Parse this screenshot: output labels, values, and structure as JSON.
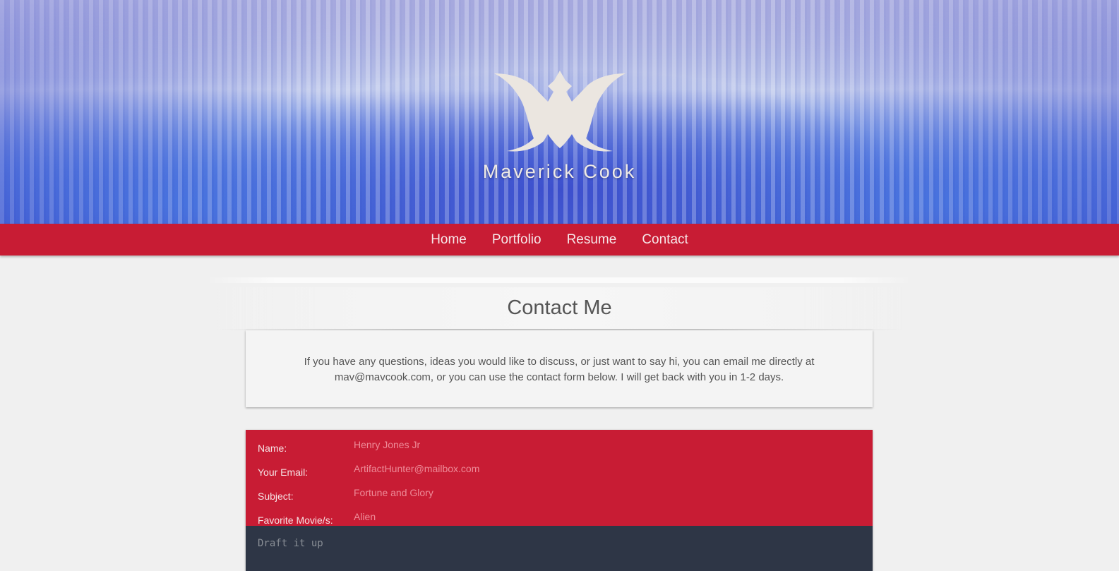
{
  "header": {
    "site_title": "Maverick Cook",
    "logo_icon": "winged-emblem-logo"
  },
  "nav": {
    "items": [
      {
        "label": "Home"
      },
      {
        "label": "Portfolio"
      },
      {
        "label": "Resume"
      },
      {
        "label": "Contact"
      }
    ]
  },
  "contact": {
    "title": "Contact Me",
    "intro": "If you have any questions, ideas you would like to discuss, or just want to say hi, you can email me directly at mav@mavcook.com, or you can use the contact form below. I will get back with you in 1-2 days."
  },
  "form": {
    "fields": [
      {
        "label": "Name:",
        "placeholder": "Henry Jones Jr"
      },
      {
        "label": "Your Email:",
        "placeholder": "ArtifactHunter@mailbox.com"
      },
      {
        "label": "Subject:",
        "placeholder": "Fortune and Glory"
      },
      {
        "label": "Favorite Movie/s:",
        "placeholder": "Alien"
      }
    ],
    "message_placeholder": "Draft it up"
  },
  "colors": {
    "accent_red": "#c81c34",
    "dark_panel": "#2e3646",
    "page_bg": "#f0f0f0"
  }
}
